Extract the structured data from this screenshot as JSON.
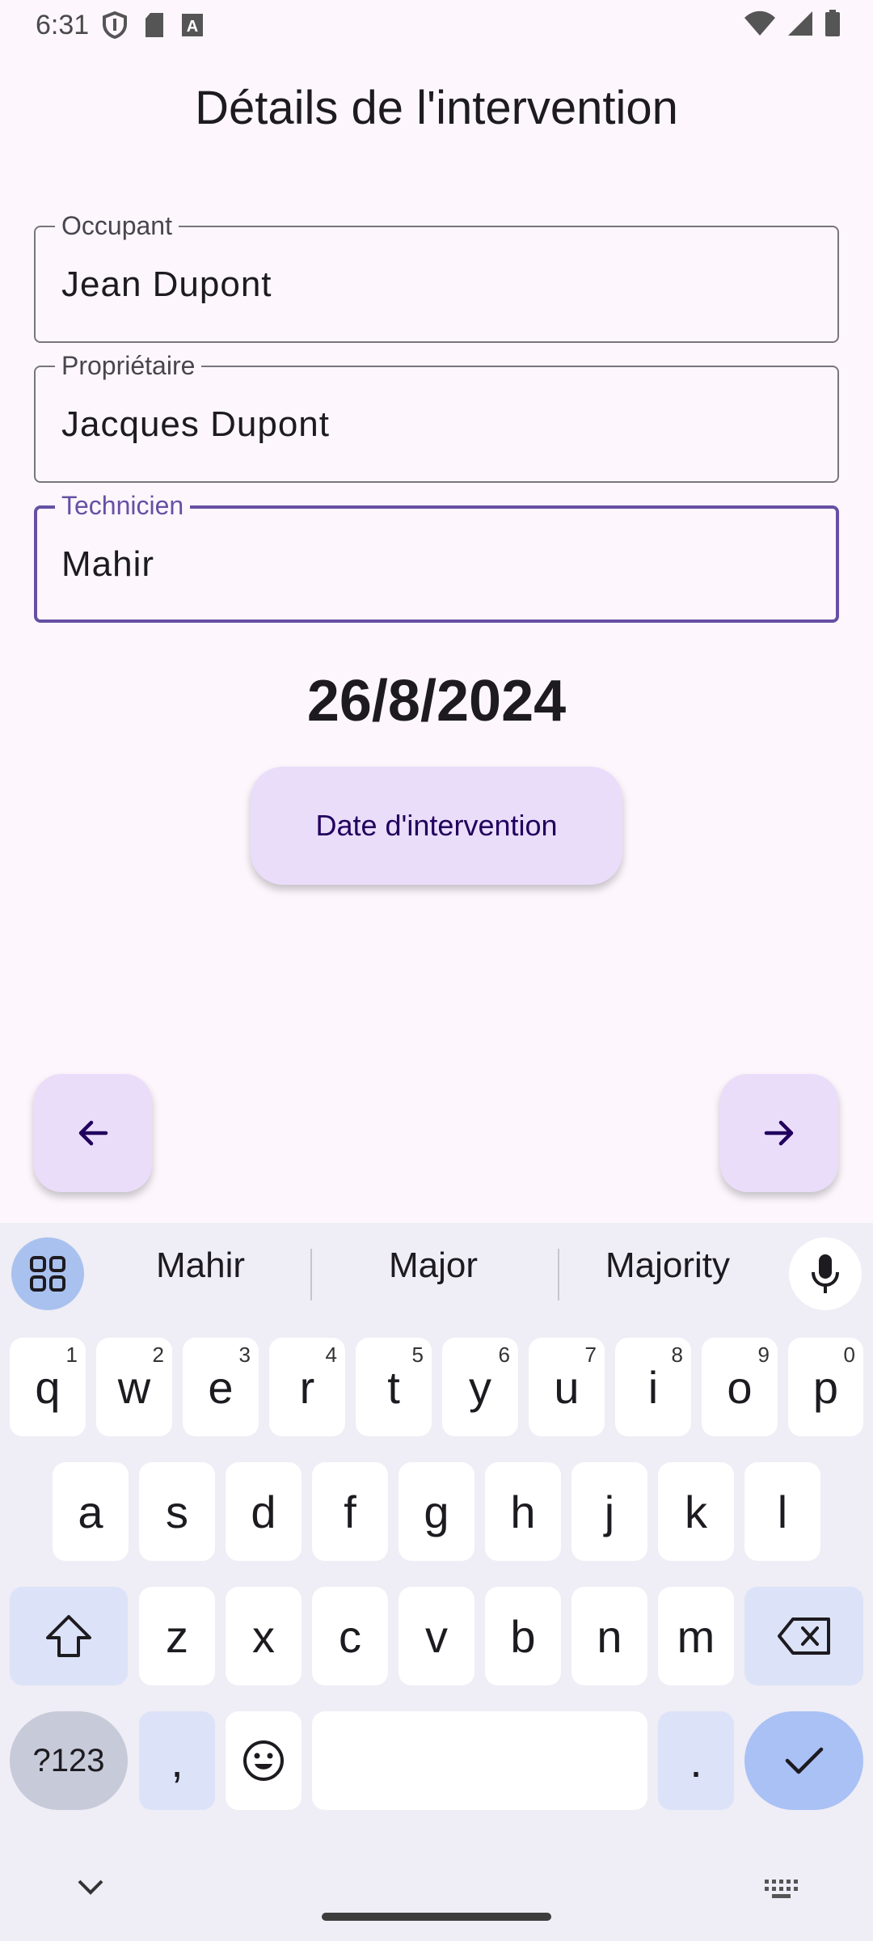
{
  "status_bar": {
    "time": "6:31"
  },
  "page": {
    "title": "Détails de l'intervention"
  },
  "fields": {
    "occupant": {
      "label": "Occupant",
      "value": "Jean Dupont"
    },
    "proprietaire": {
      "label": "Propriétaire",
      "value": "Jacques Dupont"
    },
    "technicien": {
      "label": "Technicien",
      "value": "Mahir"
    }
  },
  "date": {
    "value": "26/8/2024",
    "button_label": "Date d'intervention"
  },
  "navigation": {
    "back_icon": "arrow-left-icon",
    "next_icon": "arrow-right-icon"
  },
  "keyboard": {
    "suggestions": [
      "Mahir",
      "Major",
      "Majority"
    ],
    "row1": [
      {
        "k": "q",
        "h": "1"
      },
      {
        "k": "w",
        "h": "2"
      },
      {
        "k": "e",
        "h": "3"
      },
      {
        "k": "r",
        "h": "4"
      },
      {
        "k": "t",
        "h": "5"
      },
      {
        "k": "y",
        "h": "6"
      },
      {
        "k": "u",
        "h": "7"
      },
      {
        "k": "i",
        "h": "8"
      },
      {
        "k": "o",
        "h": "9"
      },
      {
        "k": "p",
        "h": "0"
      }
    ],
    "row2": [
      "a",
      "s",
      "d",
      "f",
      "g",
      "h",
      "j",
      "k",
      "l"
    ],
    "row3": [
      "z",
      "x",
      "c",
      "v",
      "b",
      "n",
      "m"
    ],
    "symbols_label": "?123",
    "comma": ",",
    "period": "."
  },
  "colors": {
    "accent": "#6750a4",
    "button_bg": "#eaddfa",
    "background": "#fdf7fd"
  }
}
